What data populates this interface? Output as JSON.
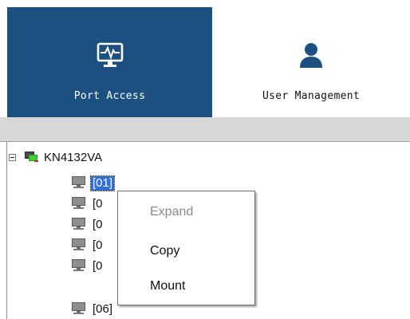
{
  "nav": {
    "port_access": {
      "label": "Port Access",
      "icon": "monitor-pulse-icon",
      "active": true,
      "color": "#1c5081"
    },
    "user_management": {
      "label": "User Management",
      "icon": "user-icon",
      "icon_color": "#1c5081"
    }
  },
  "tree": {
    "root": {
      "label": "KN4132VA",
      "expanded": true,
      "icon": "kvm-switch-icon"
    },
    "ports": [
      {
        "label": "[01]",
        "selected": true
      },
      {
        "label": "[0"
      },
      {
        "label": "[0"
      },
      {
        "label": "[0"
      },
      {
        "label": "[0"
      },
      {
        "label": "[06]"
      }
    ],
    "port_icon": "computer-icon",
    "selection_color": "#2f6fd6"
  },
  "context_menu": {
    "items": [
      {
        "label": "Expand",
        "enabled": false
      },
      {
        "label": "Copy",
        "enabled": true
      },
      {
        "label": "Mount",
        "enabled": true
      }
    ]
  }
}
